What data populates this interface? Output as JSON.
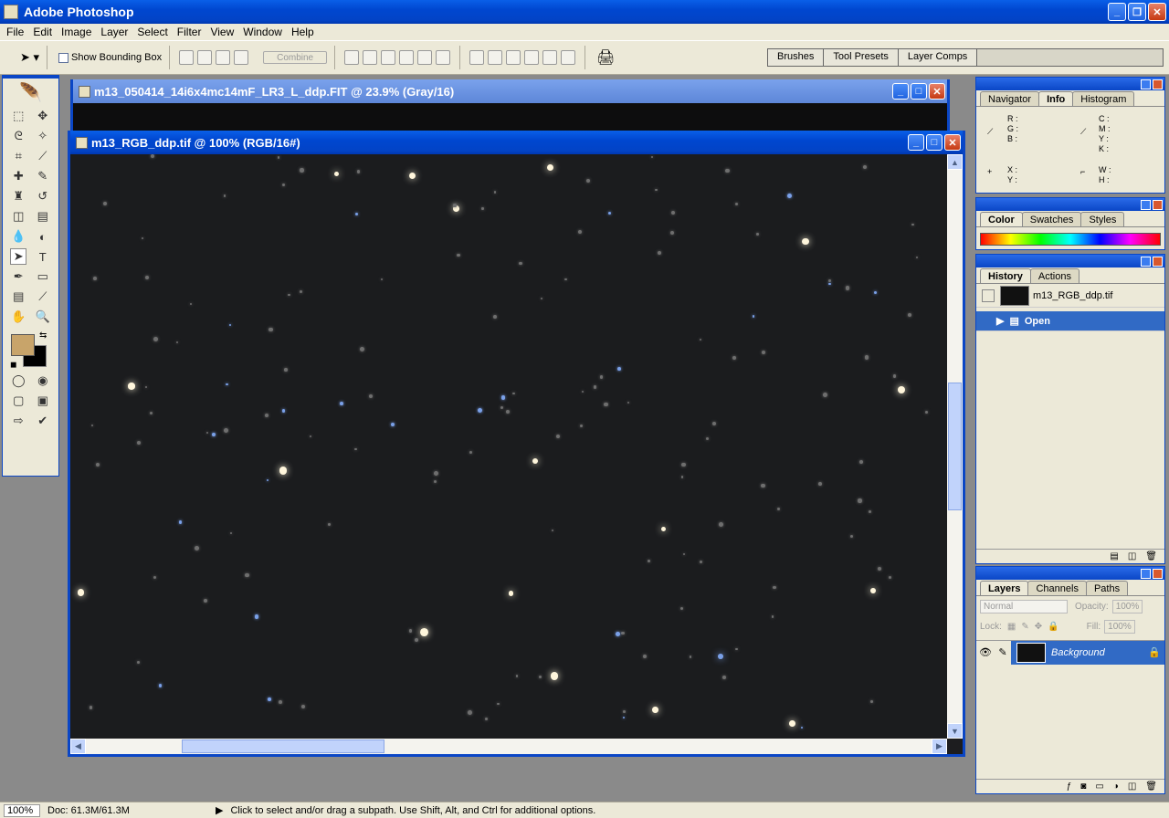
{
  "app": {
    "title": "Adobe Photoshop"
  },
  "menu": [
    "File",
    "Edit",
    "Image",
    "Layer",
    "Select",
    "Filter",
    "View",
    "Window",
    "Help"
  ],
  "options": {
    "bounding_box_label": "Show Bounding Box",
    "combine_label": "Combine"
  },
  "palette_well": [
    "Brushes",
    "Tool Presets",
    "Layer Comps"
  ],
  "doc1": {
    "title": "m13_050414_14i6x4mc14mF_LR3_L_ddp.FIT @ 23.9% (Gray/16)"
  },
  "doc2": {
    "title": "m13_RGB_ddp.tif @ 100% (RGB/16#)"
  },
  "info_panel": {
    "tabs": [
      "Navigator",
      "Info",
      "Histogram"
    ],
    "rgb": [
      "R :",
      "G :",
      "B :"
    ],
    "cmyk": [
      "C :",
      "M :",
      "Y :",
      "K :"
    ],
    "xy": [
      "X :",
      "Y :"
    ],
    "wh": [
      "W :",
      "H :"
    ]
  },
  "color_panel": {
    "tabs": [
      "Color",
      "Swatches",
      "Styles"
    ]
  },
  "history_panel": {
    "tabs": [
      "History",
      "Actions"
    ],
    "snapshot": "m13_RGB_ddp.tif",
    "step": "Open"
  },
  "layers_panel": {
    "tabs": [
      "Layers",
      "Channels",
      "Paths"
    ],
    "mode": "Normal",
    "opacity_label": "Opacity:",
    "opacity": "100%",
    "lock_label": "Lock:",
    "fill_label": "Fill:",
    "fill": "100%",
    "layer_name": "Background"
  },
  "status": {
    "zoom": "100%",
    "doc": "Doc: 61.3M/61.3M",
    "hint": "Click to select and/or drag a subpath.  Use Shift, Alt, and Ctrl for additional options."
  },
  "colors": {
    "foreground": "#c8a46a",
    "background": "#000000"
  }
}
